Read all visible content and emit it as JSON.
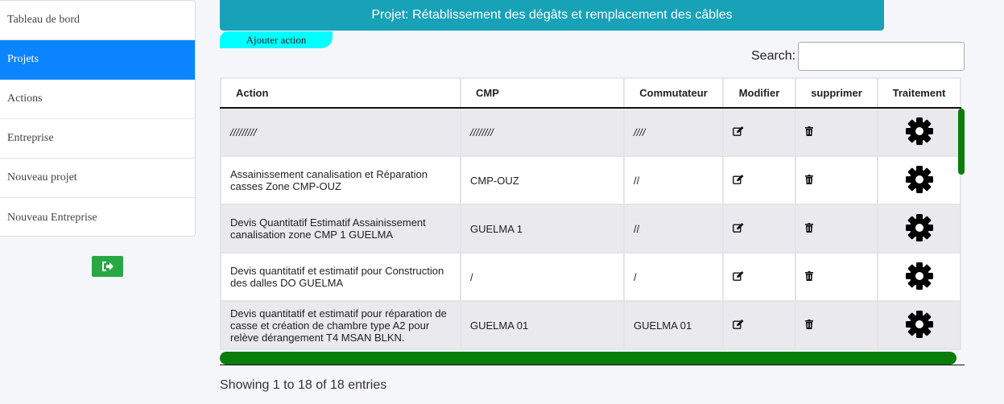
{
  "sidebar": {
    "items": [
      {
        "label": "Tableau de bord"
      },
      {
        "label": "Projets"
      },
      {
        "label": "Actions"
      },
      {
        "label": "Entreprise"
      },
      {
        "label": "Nouveau projet"
      },
      {
        "label": "Nouveau Entreprise"
      }
    ],
    "active_index": 1,
    "logout_icon": "sign-out-icon"
  },
  "header": {
    "title": "Projet: Rétablissement des dégâts et remplacement des câbles",
    "add_action_label": "Ajouter action",
    "color": "#17a2b8"
  },
  "search": {
    "label": "Search:",
    "value": ""
  },
  "table": {
    "columns": [
      "Action",
      "CMP",
      "Commutateur",
      "Modifier",
      "supprimer",
      "Traitement"
    ],
    "rows": [
      {
        "action": "/////////",
        "cmp": "////////",
        "commutateur": "////"
      },
      {
        "action": "Assainissement canalisation et Réparation casses Zone CMP-OUZ",
        "cmp": "CMP-OUZ",
        "commutateur": "//"
      },
      {
        "action": "Devis Quantitatif Estimatif Assainissement canalisation zone CMP 1 GUELMA",
        "cmp": "GUELMA 1",
        "commutateur": "//"
      },
      {
        "action": "Devis quantitatif et estimatif pour Construction des dalles DO GUELMA",
        "cmp": "/",
        "commutateur": "/"
      },
      {
        "action": "Devis quantitatif et estimatif pour réparation de casse et création de chambre type A2 pour relève dérangement T4 MSAN BLKN.",
        "cmp": "GUELMA 01",
        "commutateur": "GUELMA 01"
      }
    ]
  },
  "footer": {
    "showing": "Showing 1 to 18 of 18 entries"
  }
}
